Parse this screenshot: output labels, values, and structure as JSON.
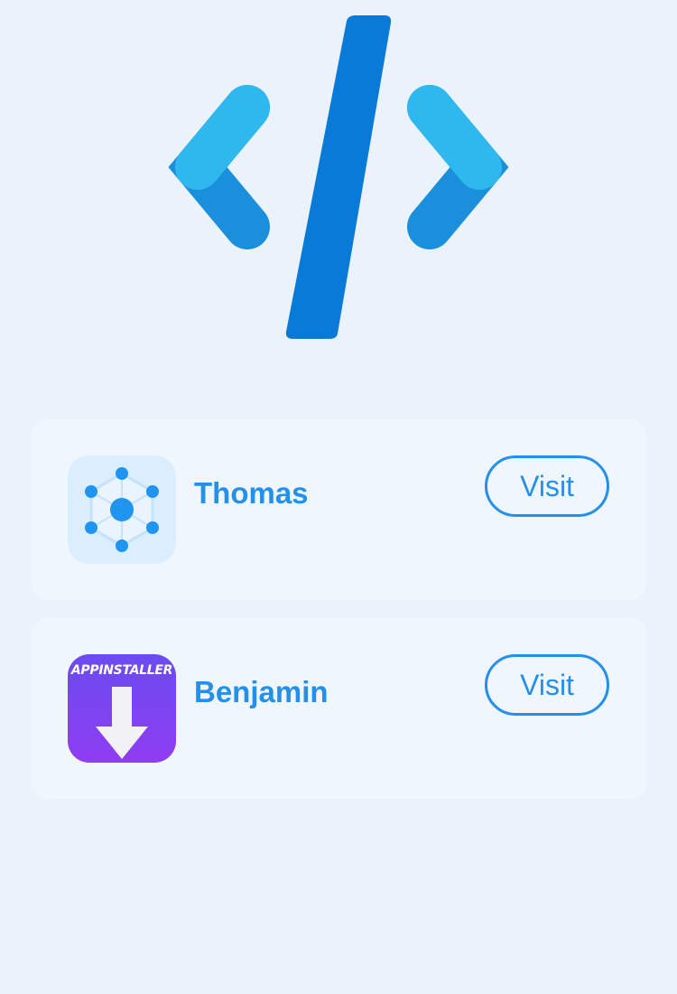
{
  "hero": {
    "icon": "code-brackets-icon",
    "colors": {
      "bracket_light": "#2fb8ee",
      "bracket_dark": "#1a8fdc",
      "slash": "#0a7ad8"
    }
  },
  "apps": [
    {
      "name": "Thomas",
      "icon": "hexagon-network-icon",
      "visit_label": "Visit"
    },
    {
      "name": "Benjamin",
      "icon": "appinstaller-icon",
      "icon_text": "APPINSTALLER",
      "visit_label": "Visit"
    }
  ],
  "colors": {
    "background": "#eaf3fc",
    "card": "#f0f6fe",
    "accent": "#2490ea"
  }
}
